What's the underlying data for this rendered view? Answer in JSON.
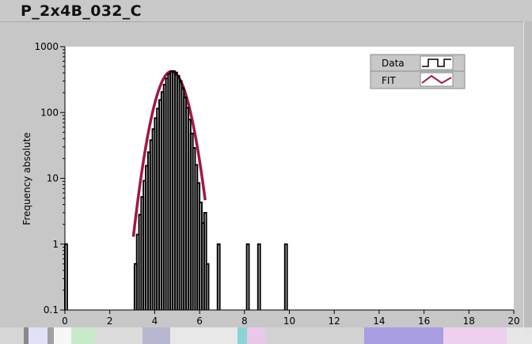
{
  "window": {
    "title": "P_2x4B_032_C"
  },
  "chart_data": {
    "type": "histogram_with_fit",
    "title": "P_2x4B_032_C",
    "xlabel": "",
    "ylabel": "Frequency absolute",
    "xlim": [
      0,
      20
    ],
    "ylim": [
      0.1,
      1000
    ],
    "y_scale": "log",
    "grid": false,
    "x_ticks": [
      0,
      2,
      4,
      6,
      8,
      10,
      12,
      14,
      16,
      18,
      20
    ],
    "x_tick_labels": [
      "0",
      "2",
      "4",
      "6",
      "8",
      "10",
      "12",
      "14",
      "16",
      "18",
      "20"
    ],
    "y_ticks": [
      0.1,
      1,
      10,
      100,
      1000
    ],
    "y_tick_labels": [
      "0.1",
      "1",
      "10",
      "100",
      "1000"
    ],
    "legend": {
      "position": "top-right",
      "entries": [
        {
          "name": "Data",
          "color": "#000000",
          "icon": "step-line-icon"
        },
        {
          "name": "FIT",
          "color": "#a0174a",
          "icon": "zigzag-line-icon"
        }
      ]
    },
    "series": [
      {
        "name": "Data",
        "kind": "step",
        "color": "#000000",
        "bin_width": 0.1,
        "bins": [
          [
            0.0,
            1
          ],
          [
            3.1,
            0.5
          ],
          [
            3.2,
            1.4
          ],
          [
            3.3,
            2.8
          ],
          [
            3.4,
            5.2
          ],
          [
            3.5,
            9.2
          ],
          [
            3.6,
            15.5
          ],
          [
            3.7,
            25
          ],
          [
            3.8,
            38
          ],
          [
            3.9,
            56
          ],
          [
            4.0,
            82
          ],
          [
            4.1,
            115
          ],
          [
            4.2,
            155
          ],
          [
            4.3,
            205
          ],
          [
            4.4,
            265
          ],
          [
            4.5,
            330
          ],
          [
            4.6,
            385
          ],
          [
            4.7,
            420
          ],
          [
            4.8,
            425
          ],
          [
            4.9,
            405
          ],
          [
            5.0,
            360
          ],
          [
            5.1,
            300
          ],
          [
            5.2,
            235
          ],
          [
            5.3,
            170
          ],
          [
            5.4,
            118
          ],
          [
            5.5,
            78
          ],
          [
            5.6,
            48
          ],
          [
            5.7,
            29
          ],
          [
            5.8,
            16
          ],
          [
            5.9,
            8.5
          ],
          [
            6.0,
            4.3
          ],
          [
            6.1,
            2.1
          ],
          [
            6.2,
            3
          ],
          [
            6.3,
            0.5
          ],
          [
            6.8,
            1
          ],
          [
            8.1,
            1
          ],
          [
            8.6,
            1
          ],
          [
            9.8,
            1
          ]
        ]
      },
      {
        "name": "FIT",
        "kind": "gaussian_curve",
        "color": "#a0174a",
        "peak": 420,
        "mean": 4.75,
        "sigma": 0.5,
        "x_range": [
          3.05,
          6.25
        ]
      }
    ]
  }
}
